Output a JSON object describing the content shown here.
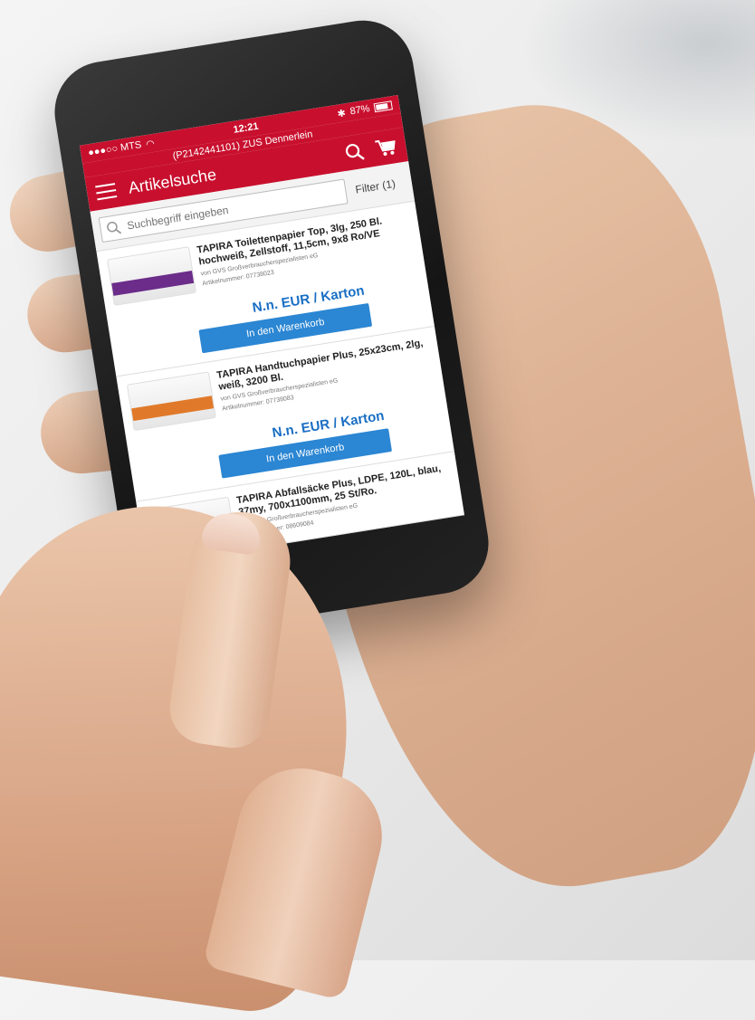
{
  "status_bar": {
    "carrier": "●●●○○ MTS",
    "time": "12:21",
    "battery": "87%"
  },
  "customer_line": "(P2142441101) ZUS Dennerlein",
  "app_bar": {
    "title": "Artikelsuche"
  },
  "search": {
    "placeholder": "Suchbegriff eingeben",
    "filter_label": "Filter (1)"
  },
  "products": [
    {
      "name": "TAPIRA Toilettenpapier Top, 3lg, 250 Bl. hochweiß, Zellstoff, 11,5cm, 9x8 Ro/VE",
      "vendor": "von GVS Großverbraucherspezialisten eG",
      "article_no": "Artikelnummer: 07738023",
      "price": "N.n. EUR / Karton",
      "button": "In den Warenkorb"
    },
    {
      "name": "TAPIRA Handtuchpapier Plus, 25x23cm, 2lg, weiß, 3200 Bl.",
      "vendor": "von GVS Großverbraucherspezialisten eG",
      "article_no": "Artikelnummer: 07738083",
      "price": "N.n. EUR / Karton",
      "button": "In den Warenkorb"
    },
    {
      "name": "TAPIRA Abfallsäcke Plus, LDPE, 120L, blau, 37my, 700x1100mm, 25 St/Ro.",
      "vendor": "von GVS Großverbraucherspezialisten eG",
      "article_no": "Artikelnummer: 08609084"
    }
  ],
  "colors": {
    "brand_red": "#c8102e",
    "button_blue": "#2b86d3",
    "price_blue": "#1a6fc4"
  }
}
